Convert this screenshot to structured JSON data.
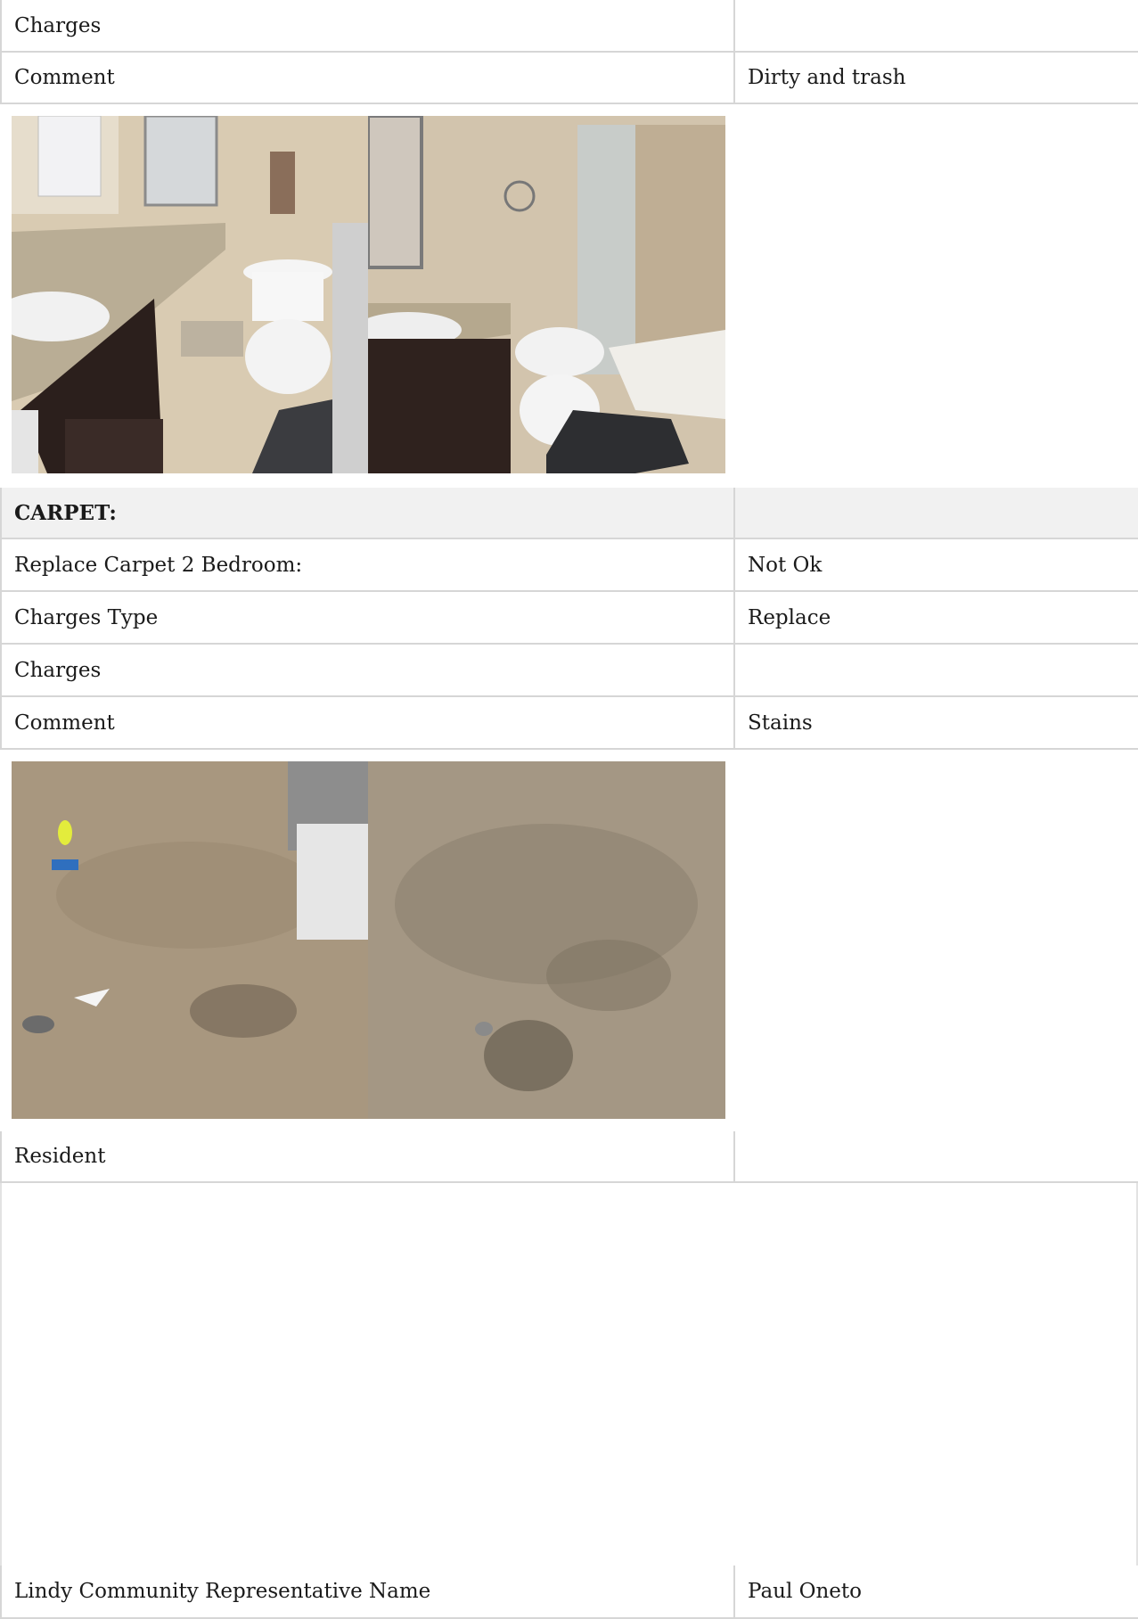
{
  "rows_top": [
    {
      "label": "Charges",
      "value": ""
    },
    {
      "label": "Comment",
      "value": "Dirty and trash"
    }
  ],
  "bathroom_photos": [
    {
      "name": "bathroom-photo-1"
    },
    {
      "name": "bathroom-photo-2"
    }
  ],
  "carpet": {
    "heading": "CARPET:",
    "rows": [
      {
        "label": "Replace Carpet 2 Bedroom:",
        "value": "Not Ok"
      },
      {
        "label": "Charges Type",
        "value": "Replace"
      },
      {
        "label": "Charges",
        "value": ""
      },
      {
        "label": "Comment",
        "value": "Stains"
      }
    ]
  },
  "resident": {
    "label": "Resident",
    "value": ""
  },
  "representative": {
    "label": "Lindy Community Representative Name",
    "value": "Paul Oneto"
  }
}
